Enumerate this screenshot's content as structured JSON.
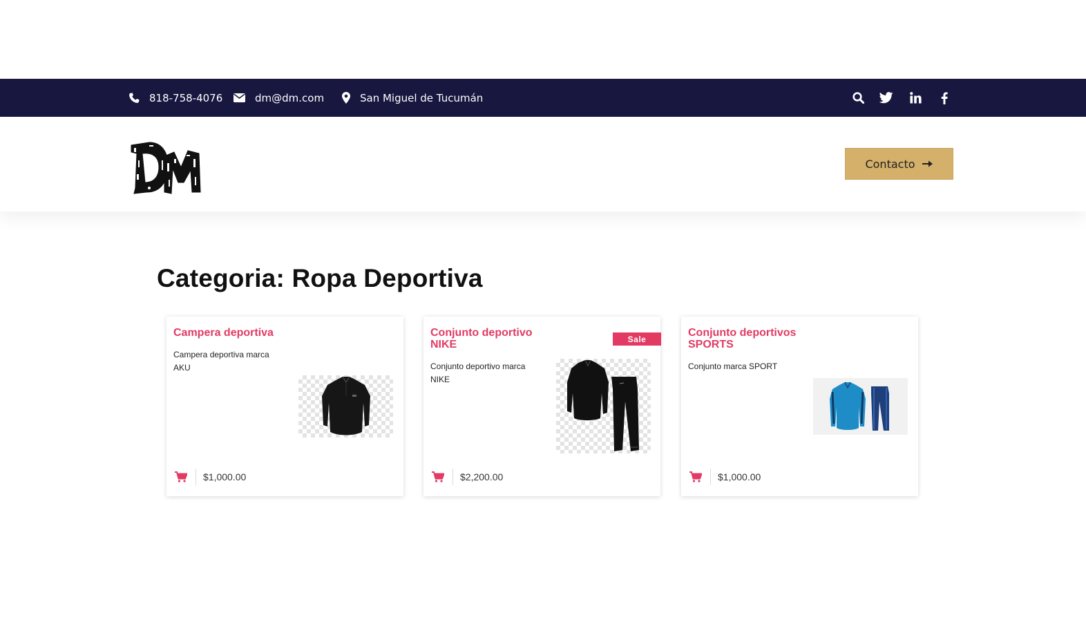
{
  "topbar": {
    "phone": "818-758-4076",
    "email": "dm@dm.com",
    "location": "San Miguel de Tucumán",
    "icons": [
      "search-icon",
      "twitter-icon",
      "linkedin-icon",
      "facebook-icon"
    ],
    "background": "#171740"
  },
  "header": {
    "logo_text": "DM",
    "contact_button": "Contacto",
    "contact_button_color": "#d4b06a"
  },
  "page": {
    "title": "Categoria: Ropa Deportiva"
  },
  "products": [
    {
      "title": "Campera deportiva",
      "description": "Campera deportiva marca AKU",
      "price": "$1,000.00",
      "sale": null,
      "image": "black-jacket"
    },
    {
      "title": "Conjunto deportivo NIKE",
      "description": "Conjunto deportivo marca NIKE",
      "price": "$2,200.00",
      "sale": "Sale",
      "image": "black-tracksuit"
    },
    {
      "title": "Conjunto deportivos SPORTS",
      "description": "Conjunto marca SPORT",
      "price": "$1,000.00",
      "sale": null,
      "image": "blue-tracksuit"
    }
  ],
  "accent_color": "#e23a63"
}
